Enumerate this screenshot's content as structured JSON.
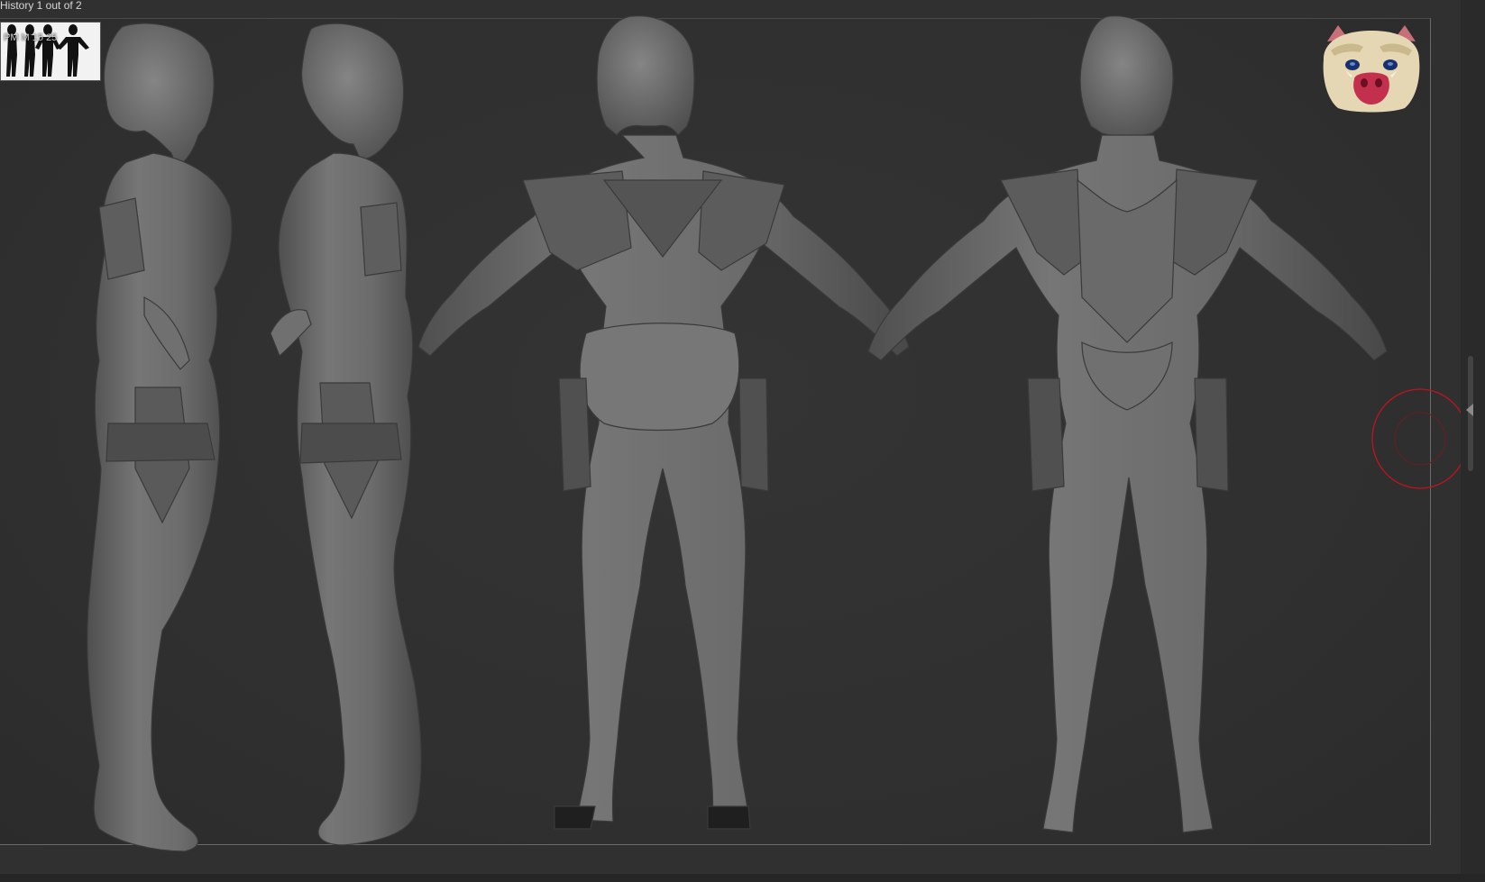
{
  "viewport": {
    "history_label": "History 1 out of 2",
    "thumbnail_caption": "PM  M   15   25",
    "background_color": "#303030",
    "model_color": "#6e6e6e",
    "cursor_color": "#c0141c"
  },
  "icons": {
    "thumbnail": "reference-silhouettes-icon",
    "mascot": "boar-mask-icon",
    "cursor": "brush-cursor-icon",
    "scroll": "scroll-handle-icon"
  }
}
